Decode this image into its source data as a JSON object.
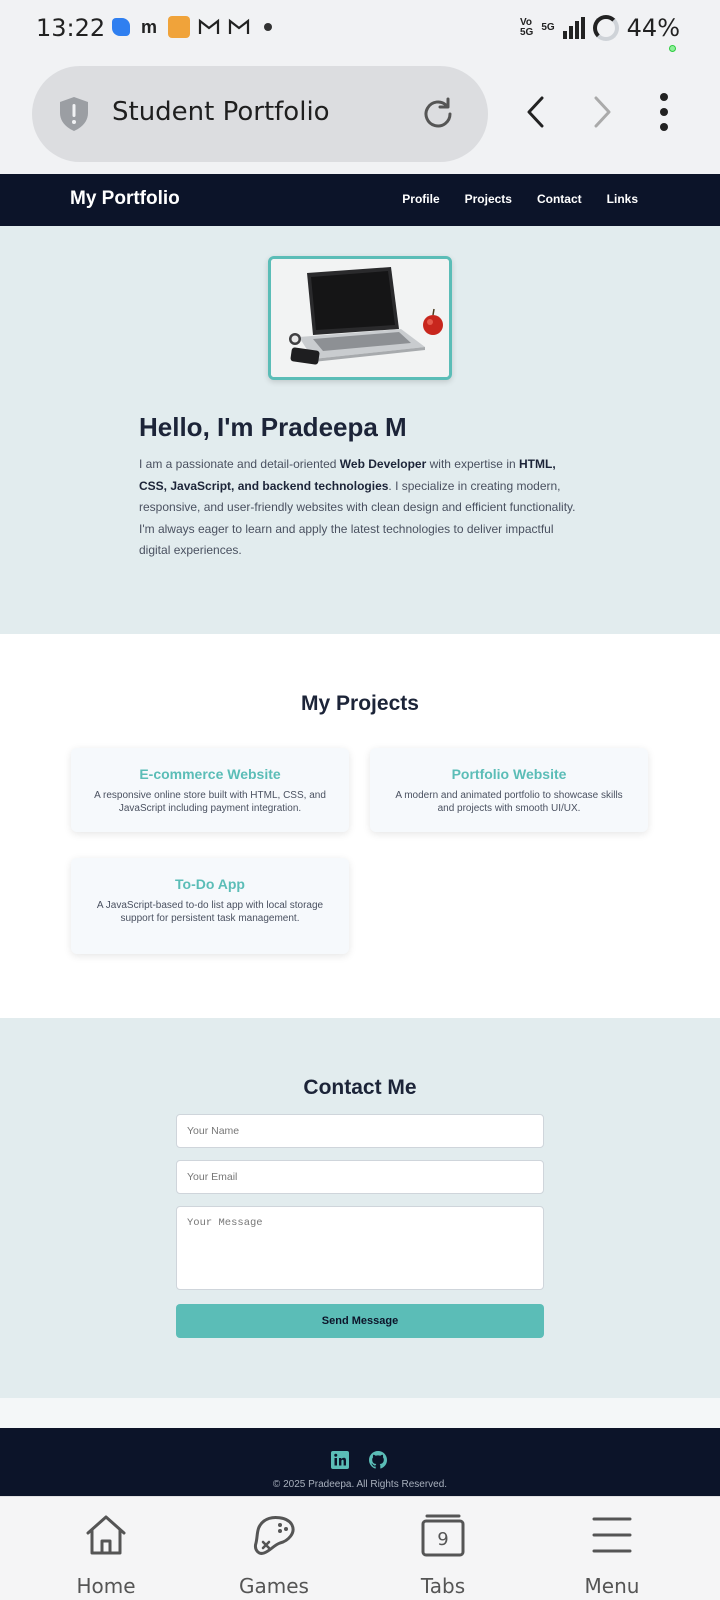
{
  "status_bar": {
    "time": "13:22",
    "network_top": "Vo",
    "network_bottom": "5G",
    "signal_label": "5G",
    "battery": "44%"
  },
  "browser": {
    "tab_title": "Student Portfolio"
  },
  "site": {
    "brand": "My Portfolio",
    "nav": [
      "Profile",
      "Projects",
      "Contact",
      "Links"
    ]
  },
  "hero": {
    "title": "Hello, I'm Pradeepa M",
    "text_1": "I am a passionate and detail-oriented ",
    "text_bold_1": "Web Developer",
    "text_2": " with expertise in ",
    "text_bold_2": "HTML, CSS, JavaScript, and backend technologies",
    "text_3": ". I specialize in creating modern, responsive, and user-friendly websites with clean design and efficient functionality. I'm always eager to learn and apply the latest technologies to deliver impactful digital experiences."
  },
  "projects": {
    "title": "My Projects",
    "items": [
      {
        "title": "E-commerce Website",
        "desc": "A responsive online store built with HTML, CSS, and JavaScript including payment integration."
      },
      {
        "title": "Portfolio Website",
        "desc": "A modern and animated portfolio to showcase skills and projects with smooth UI/UX."
      },
      {
        "title": "To-Do App",
        "desc": "A JavaScript-based to-do list app with local storage support for persistent task management."
      }
    ]
  },
  "contact": {
    "title": "Contact Me",
    "name_placeholder": "Your Name",
    "email_placeholder": "Your Email",
    "message_placeholder": "Your Message",
    "send_label": "Send Message"
  },
  "footer": {
    "copyright": "© 2025 Pradeepa. All Rights Reserved.",
    "icons": [
      "linkedin-icon",
      "github-icon"
    ]
  },
  "bottom_bar": {
    "home": "Home",
    "games": "Games",
    "tabs": "Tabs",
    "tabs_count": "9",
    "menu": "Menu"
  },
  "colors": {
    "navy": "#0c1429",
    "teal": "#5bbdb7",
    "hero_bg": "#e2ecee"
  }
}
